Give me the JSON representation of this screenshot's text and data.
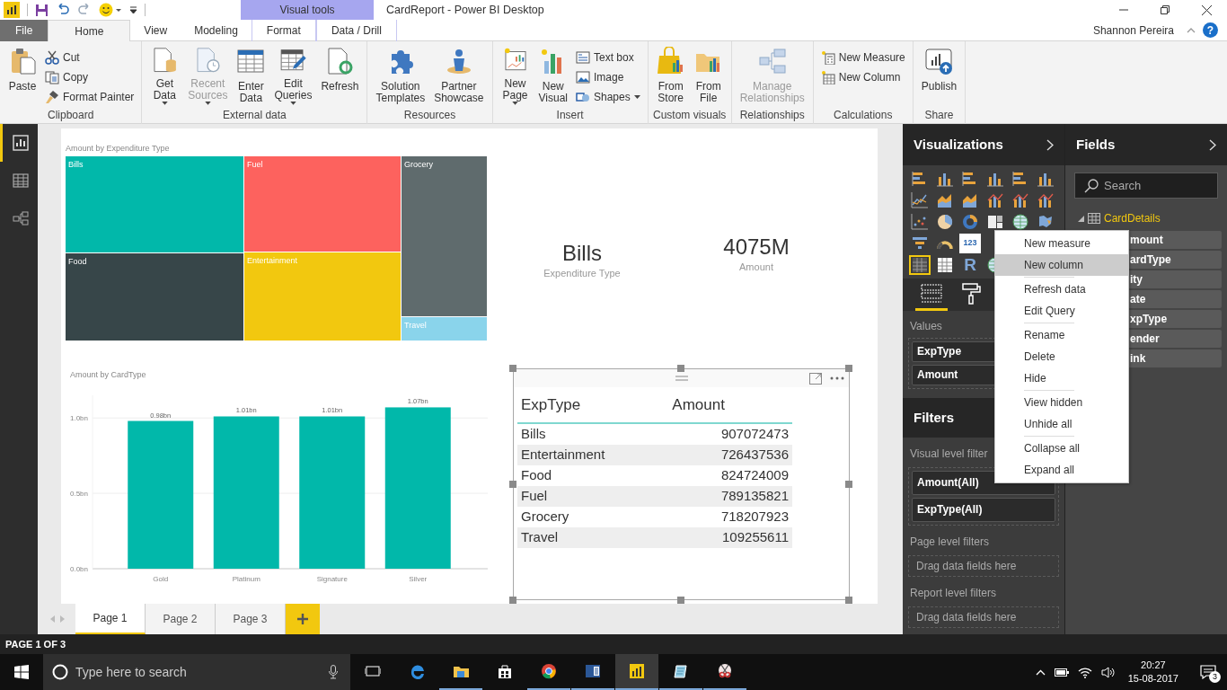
{
  "title_bar": {
    "title": "CardReport - Power BI Desktop",
    "context_tab_group": "Visual tools"
  },
  "ribbon_tabs": [
    {
      "label": "File",
      "kind": "file",
      "selected": false
    },
    {
      "label": "Home",
      "kind": "normal",
      "selected": true
    },
    {
      "label": "View",
      "kind": "normal",
      "selected": false
    },
    {
      "label": "Modeling",
      "kind": "normal",
      "selected": false
    },
    {
      "label": "Format",
      "kind": "contextual",
      "selected": false
    },
    {
      "label": "Data / Drill",
      "kind": "contextual",
      "selected": false
    }
  ],
  "user": {
    "name": "Shannon Pereira",
    "help_label": "?"
  },
  "ribbon_groups": [
    {
      "name": "Clipboard",
      "buttons": [
        {
          "label": "Paste",
          "kind": "large",
          "dropdown": false,
          "disabled": false
        },
        {
          "label": "Cut",
          "kind": "small",
          "dropdown": false,
          "disabled": false
        },
        {
          "label": "Copy",
          "kind": "small",
          "dropdown": false,
          "disabled": false
        },
        {
          "label": "Format Painter",
          "kind": "small",
          "dropdown": false,
          "disabled": false
        }
      ]
    },
    {
      "name": "External data",
      "buttons": [
        {
          "label": "Get\nData",
          "kind": "large",
          "dropdown": true,
          "disabled": false
        },
        {
          "label": "Recent\nSources",
          "kind": "large",
          "dropdown": true,
          "disabled": true
        },
        {
          "label": "Enter\nData",
          "kind": "large",
          "dropdown": false,
          "disabled": false
        },
        {
          "label": "Edit\nQueries",
          "kind": "large",
          "dropdown": true,
          "disabled": false
        },
        {
          "label": "Refresh",
          "kind": "large",
          "dropdown": false,
          "disabled": false
        }
      ]
    },
    {
      "name": "Resources",
      "buttons": [
        {
          "label": "Solution\nTemplates",
          "kind": "large",
          "dropdown": false,
          "disabled": false
        },
        {
          "label": "Partner\nShowcase",
          "kind": "large",
          "dropdown": false,
          "disabled": false
        }
      ]
    },
    {
      "name": "Insert",
      "buttons": [
        {
          "label": "New\nPage",
          "kind": "large",
          "dropdown": true,
          "disabled": false
        },
        {
          "label": "New\nVisual",
          "kind": "large",
          "dropdown": false,
          "disabled": false
        },
        {
          "label": "Text box",
          "kind": "small",
          "dropdown": false,
          "disabled": false
        },
        {
          "label": "Image",
          "kind": "small",
          "dropdown": false,
          "disabled": false
        },
        {
          "label": "Shapes",
          "kind": "small",
          "dropdown": true,
          "disabled": false
        }
      ]
    },
    {
      "name": "Custom visuals",
      "buttons": [
        {
          "label": "From\nStore",
          "kind": "large",
          "dropdown": false,
          "disabled": false
        },
        {
          "label": "From\nFile",
          "kind": "large",
          "dropdown": false,
          "disabled": false
        }
      ]
    },
    {
      "name": "Relationships",
      "buttons": [
        {
          "label": "Manage\nRelationships",
          "kind": "large",
          "dropdown": false,
          "disabled": true
        }
      ]
    },
    {
      "name": "Calculations",
      "buttons": [
        {
          "label": "New Measure",
          "kind": "small",
          "dropdown": false,
          "disabled": false
        },
        {
          "label": "New Column",
          "kind": "small",
          "dropdown": false,
          "disabled": false
        }
      ]
    },
    {
      "name": "Share",
      "buttons": [
        {
          "label": "Publish",
          "kind": "large",
          "dropdown": false,
          "disabled": false
        }
      ]
    }
  ],
  "left_nav": [
    {
      "kind": "report",
      "selected": true
    },
    {
      "kind": "data",
      "selected": false
    },
    {
      "kind": "model",
      "selected": false
    }
  ],
  "report": {
    "treemap": {
      "title": "Amount by Expenditure Type",
      "tiles": [
        {
          "label": "Bills",
          "color": "#01b8aa"
        },
        {
          "label": "Fuel",
          "color": "#fd625e"
        },
        {
          "label": "Grocery",
          "color": "#5f6b6d"
        },
        {
          "label": "Food",
          "color": "#374649"
        },
        {
          "label": "Entertainment",
          "color": "#f2c80f"
        },
        {
          "label": "Travel",
          "color": "#8ad4eb"
        }
      ]
    },
    "cards": [
      {
        "value": "Bills",
        "label": "Expenditure Type"
      },
      {
        "value": "4075M",
        "label": "Amount"
      }
    ],
    "bar_chart": {
      "chart_data": {
        "type": "bar",
        "title": "Amount by CardType",
        "categories": [
          "Gold",
          "Platinum",
          "Signature",
          "Silver"
        ],
        "series": [
          {
            "color": "#01b8aa",
            "values": [
              0.98,
              1.01,
              1.01,
              1.07
            ]
          }
        ],
        "ylim": [
          0,
          1.15
        ],
        "yticks": [
          {
            "value": 0,
            "label": "0.0bn"
          },
          {
            "value": 0.5,
            "label": "0.5bn"
          },
          {
            "value": 1,
            "label": "1.0bn"
          }
        ],
        "value_labels": [
          "0.98bn",
          "1.01bn",
          "1.01bn",
          "1.07bn"
        ]
      }
    },
    "table": {
      "selected": true,
      "columns": [
        "ExpType",
        "Amount"
      ],
      "rows": [
        [
          "Bills",
          "907072473"
        ],
        [
          "Entertainment",
          "726437536"
        ],
        [
          "Food",
          "824724009"
        ],
        [
          "Fuel",
          "789135821"
        ],
        [
          "Grocery",
          "718207923"
        ],
        [
          "Travel",
          "109255611"
        ]
      ]
    }
  },
  "page_tabs": [
    {
      "label": "Page 1",
      "selected": true
    },
    {
      "label": "Page 2",
      "selected": false
    },
    {
      "label": "Page 3",
      "selected": false
    }
  ],
  "status_bar": "PAGE 1 OF 3",
  "visualizations": {
    "title": "Visualizations",
    "icon_rows": [
      [
        {
          "kind": "stacked-bar",
          "selected": false
        },
        {
          "kind": "stacked-column",
          "selected": false
        },
        {
          "kind": "clustered-bar",
          "selected": false
        },
        {
          "kind": "clustered-column",
          "selected": false
        },
        {
          "kind": "percent-bar",
          "selected": false
        },
        {
          "kind": "percent-column",
          "selected": false
        }
      ],
      [
        {
          "kind": "line",
          "selected": false
        },
        {
          "kind": "area",
          "selected": false
        },
        {
          "kind": "stacked-area",
          "selected": false
        },
        {
          "kind": "line-column",
          "selected": false
        },
        {
          "kind": "line-clustered",
          "selected": false
        },
        {
          "kind": "ribbon",
          "selected": false
        }
      ],
      [
        {
          "kind": "scatter",
          "selected": false
        },
        {
          "kind": "pie",
          "selected": false
        },
        {
          "kind": "donut",
          "selected": false
        },
        {
          "kind": "treemap",
          "selected": false
        },
        {
          "kind": "map",
          "selected": false
        },
        {
          "kind": "filled-map",
          "selected": false
        }
      ],
      [
        {
          "kind": "funnel",
          "selected": false
        },
        {
          "kind": "gauge",
          "selected": false
        },
        {
          "kind": "card",
          "glyph": "123",
          "selected": false
        }
      ],
      [
        {
          "kind": "table",
          "selected": true
        },
        {
          "kind": "matrix",
          "selected": false
        },
        {
          "kind": "r-script",
          "glyph": "R",
          "selected": false
        },
        {
          "kind": "globe",
          "selected": false
        }
      ]
    ],
    "pane_tabs": [
      {
        "kind": "fields",
        "selected": true
      },
      {
        "kind": "format",
        "selected": false
      }
    ],
    "wells": [
      {
        "label": "Values",
        "fields": [
          "ExpType",
          "Amount"
        ]
      }
    ]
  },
  "filters": {
    "title": "Filters",
    "sections": [
      {
        "label": "Visual level filter",
        "pills": [
          "Amount(All)",
          "ExpType(All)"
        ]
      },
      {
        "label": "Page level filters",
        "drop_hint": "Drag data fields here"
      },
      {
        "label": "Report level filters",
        "drop_hint": "Drag data fields here"
      }
    ]
  },
  "fields": {
    "title": "Fields",
    "search_placeholder": "Search",
    "table": {
      "name": "CardDetails",
      "fields": [
        "mount",
        "ardType",
        "ity",
        "ate",
        "xpType",
        "ender",
        "ink"
      ]
    }
  },
  "context_menu": {
    "groups": [
      [
        {
          "label": "New measure",
          "selected": false
        },
        {
          "label": "New column",
          "selected": true
        }
      ],
      [
        {
          "label": "Refresh data",
          "selected": false
        },
        {
          "label": "Edit Query",
          "selected": false
        }
      ],
      [
        {
          "label": "Rename",
          "selected": false
        },
        {
          "label": "Delete",
          "selected": false
        },
        {
          "label": "Hide",
          "selected": false
        }
      ],
      [
        {
          "label": "View hidden",
          "selected": false
        },
        {
          "label": "Unhide all",
          "selected": false
        }
      ],
      [
        {
          "label": "Collapse all",
          "selected": false
        },
        {
          "label": "Expand all",
          "selected": false
        }
      ]
    ]
  },
  "taskbar": {
    "search_placeholder": "Type here to search",
    "apps": [
      {
        "kind": "task-view",
        "running": false,
        "active": false
      },
      {
        "kind": "edge",
        "running": false,
        "active": false
      },
      {
        "kind": "explorer",
        "running": true,
        "active": false
      },
      {
        "kind": "store",
        "running": false,
        "active": false
      },
      {
        "kind": "chrome",
        "running": true,
        "active": false
      },
      {
        "kind": "word",
        "running": true,
        "active": false
      },
      {
        "kind": "power-bi",
        "running": true,
        "active": true
      },
      {
        "kind": "notes",
        "running": true,
        "active": false
      },
      {
        "kind": "snipping",
        "running": true,
        "active": false
      }
    ],
    "time": "20:27",
    "date": "15-08-2017",
    "notification_count": "3"
  }
}
